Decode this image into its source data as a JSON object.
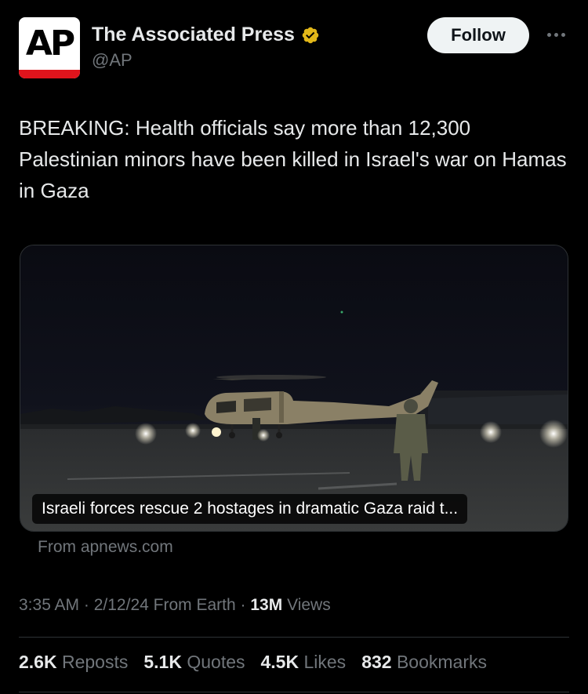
{
  "account": {
    "avatar_text": "AP",
    "name": "The Associated Press",
    "handle": "@AP",
    "verified": true,
    "verified_icon": "gold-verified-badge-icon",
    "follow_label": "Follow"
  },
  "tweet": {
    "text": "BREAKING: Health officials say more than 12,300 Palestinian minors have been killed in Israel's war on Hamas in Gaza"
  },
  "card": {
    "image_description": "helicopter-at-night-photo",
    "caption": "Israeli forces rescue 2 hostages in dramatic Gaza raid t...",
    "source": "From apnews.com"
  },
  "meta": {
    "time": "3:35 AM",
    "date": "2/12/24",
    "location": "From Earth",
    "views_count": "13M",
    "views_label": "Views"
  },
  "stats": {
    "reposts_count": "2.6K",
    "reposts_label": "Reposts",
    "quotes_count": "5.1K",
    "quotes_label": "Quotes",
    "likes_count": "4.5K",
    "likes_label": "Likes",
    "bookmarks_count": "832",
    "bookmarks_label": "Bookmarks"
  },
  "colors": {
    "background": "#000000",
    "text": "#e7e9ea",
    "muted": "#71767b",
    "ap_red": "#e0141c",
    "verified_gold": "#e2b719"
  }
}
